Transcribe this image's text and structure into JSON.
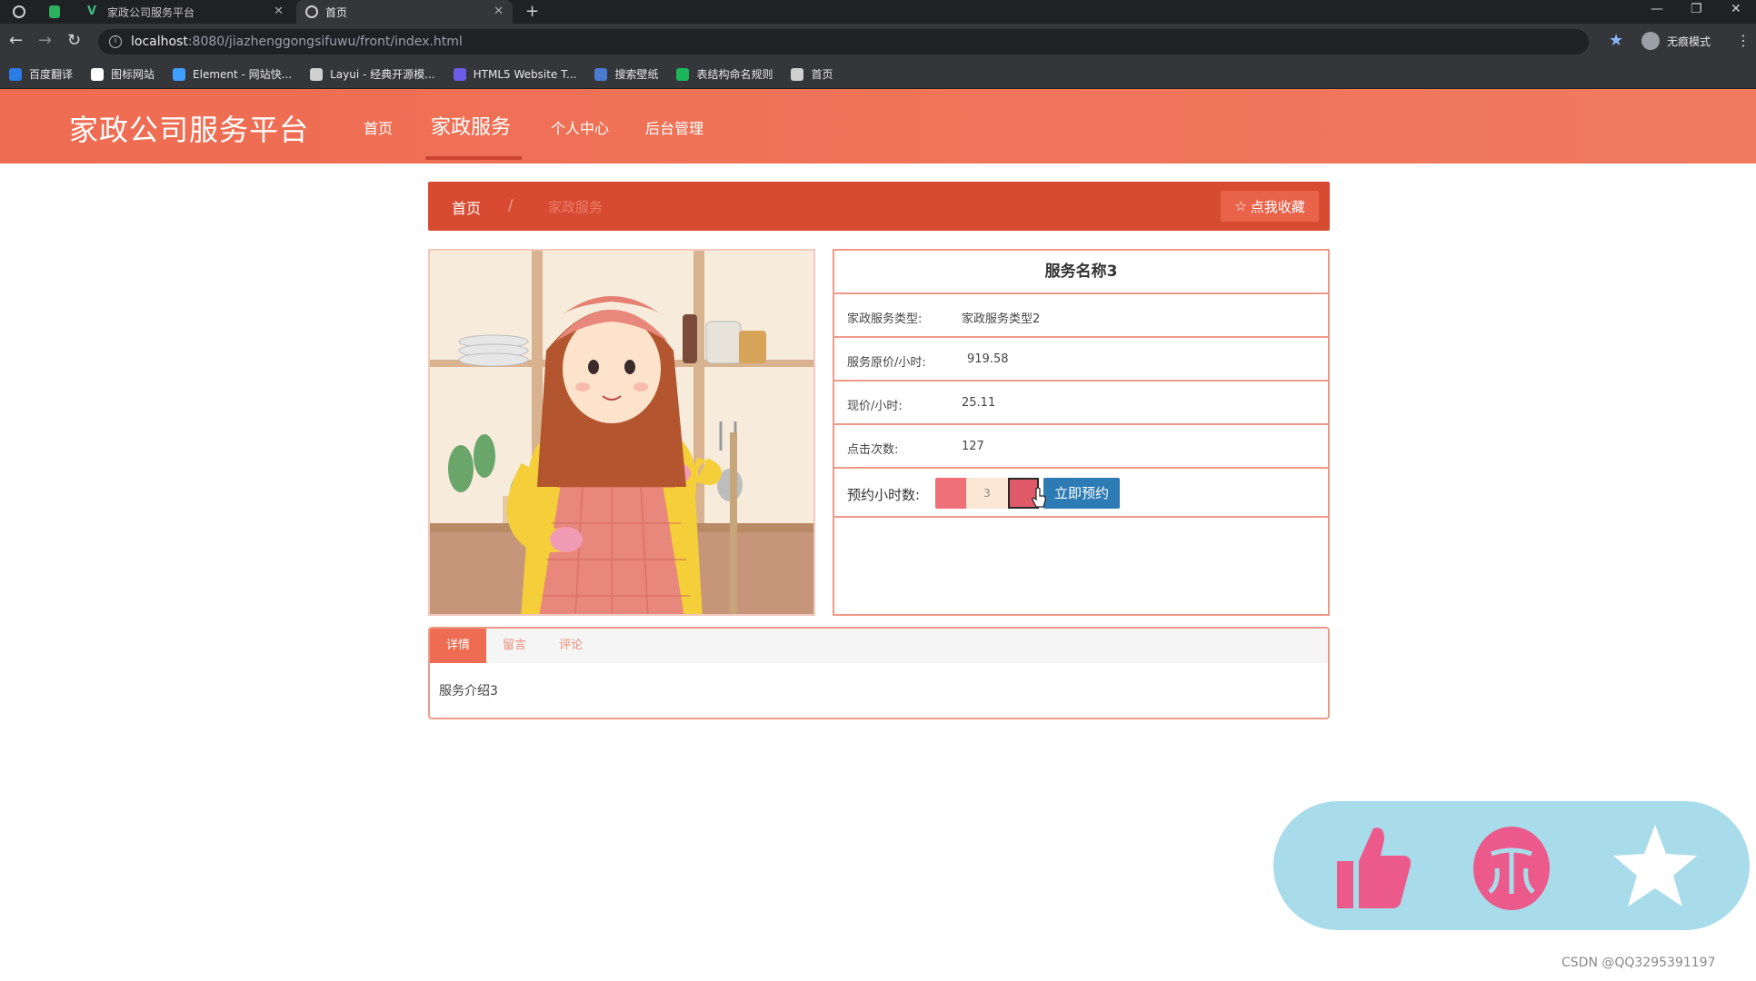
{
  "browser": {
    "tabs": [
      {
        "title": "",
        "type": "pinned"
      },
      {
        "title": "",
        "type": "pinned"
      },
      {
        "title": "家政公司服务平台",
        "type": "tab"
      },
      {
        "title": "首页",
        "type": "tab",
        "active": true
      }
    ],
    "url_host": "localhost",
    "url_path": ":8080/jiazhenggongsifuwu/front/index.html",
    "profile_label": "无痕模式",
    "bookmarks": [
      {
        "label": "百度翻译",
        "color": "#2d7be5"
      },
      {
        "label": "图标网站",
        "color": "#ffffff"
      },
      {
        "label": "Element - 网站快...",
        "color": "#409eff"
      },
      {
        "label": "Layui - 经典开源模...",
        "color": "#cfcfcf"
      },
      {
        "label": "HTML5 Website T...",
        "color": "#6b5de6"
      },
      {
        "label": "搜索壁纸",
        "color": "#4a7bd0"
      },
      {
        "label": "表结构命名规则",
        "color": "#1bb55c"
      },
      {
        "label": "首页",
        "color": "#cfcfcf"
      }
    ]
  },
  "header": {
    "logo": "家政公司服务平台",
    "nav": [
      {
        "label": "首页"
      },
      {
        "label": "家政服务",
        "active": true
      },
      {
        "label": "个人中心"
      },
      {
        "label": "后台管理"
      }
    ]
  },
  "breadcrumb": {
    "home": "首页",
    "separator": "/",
    "current": "家政服务",
    "favorite_button": "点我收藏"
  },
  "detail": {
    "title": "服务名称3",
    "rows": [
      {
        "label": "家政服务类型:",
        "value": "家政服务类型2"
      },
      {
        "label": "服务原价/小时:",
        "value": "919.58"
      },
      {
        "label": "现价/小时:",
        "value": "25.11"
      },
      {
        "label": "点击次数:",
        "value": "127"
      }
    ],
    "booking": {
      "label": "预约小时数:",
      "hours_value": "3",
      "book_button": "立即预约"
    }
  },
  "tabs": {
    "items": [
      {
        "label": "详情",
        "active": true
      },
      {
        "label": "留言"
      },
      {
        "label": "评论"
      }
    ],
    "content": "服务介绍3"
  },
  "floating_actions": {
    "icons": [
      "thumbs-up-icon",
      "coin-icon",
      "star-icon"
    ],
    "bg_color": "#a8dcea",
    "accent": "#ec5a8c"
  },
  "watermark": "CSDN @QQ3295391197",
  "colors": {
    "primary": "#ee6c52",
    "breadcrumb_bg": "#d84b33",
    "border": "#ef9a88",
    "book_button": "#2c7bb5"
  }
}
